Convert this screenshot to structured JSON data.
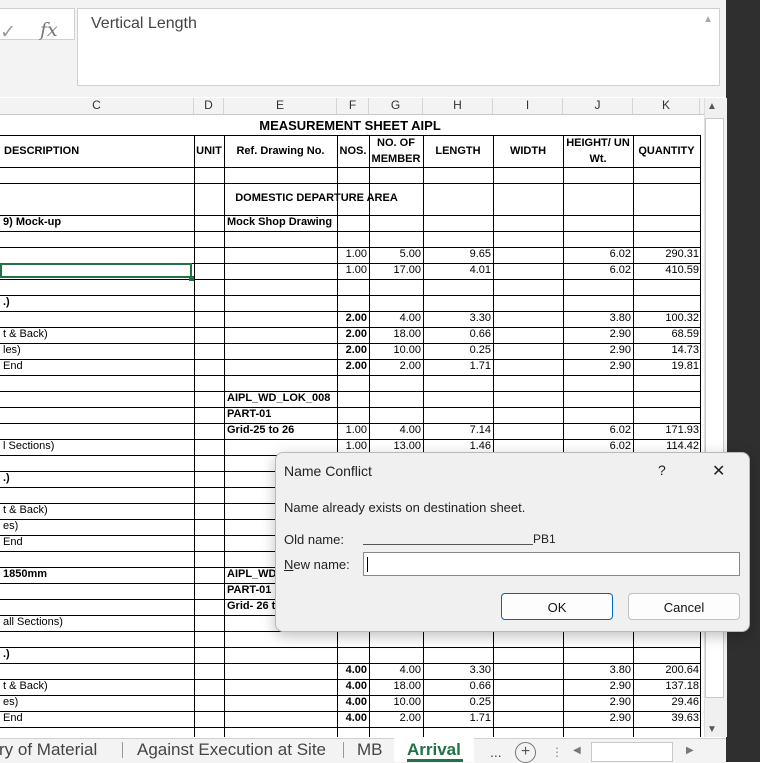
{
  "formula_bar": {
    "check_glyph": "✓",
    "fx_label": "fx",
    "value": "Vertical Length"
  },
  "columns": [
    "C",
    "D",
    "E",
    "F",
    "G",
    "H",
    "I",
    "J",
    "K"
  ],
  "sheet": {
    "title": "MEASUREMENT SHEET AIPL",
    "headers": {
      "description": "DESCRIPTION",
      "unit": "UNIT",
      "ref_drawing": "Ref. Drawing No.",
      "nos": "NOS.",
      "no_of_member_1": "NO. OF",
      "no_of_member_2": "MEMBER",
      "length": "LENGTH",
      "width": "WIDTH",
      "height_1": "HEIGHT/ UN",
      "height_2": "Wt.",
      "quantity": "QUANTITY"
    },
    "section": "DOMESTIC DEPARTURE AREA",
    "rows": [
      {
        "c": "9) Mock-up",
        "e": "Mock Shop Drawing",
        "bold_c": true,
        "bold_e": true
      },
      {},
      {
        "f": "1.00",
        "g": "5.00",
        "h": "9.65",
        "j": "6.02",
        "k": "290.31"
      },
      {
        "f": "1.00",
        "g": "17.00",
        "h": "4.01",
        "j": "6.02",
        "k": "410.59"
      },
      {},
      {
        "c": ".)",
        "bold_c": true
      },
      {
        "f": "2.00",
        "g": "4.00",
        "h": "3.30",
        "j": "3.80",
        "k": "100.32",
        "bold_f": true
      },
      {
        "c": "t & Back)",
        "f": "2.00",
        "g": "18.00",
        "h": "0.66",
        "j": "2.90",
        "k": "68.59",
        "bold_f": true
      },
      {
        "c": "les)",
        "f": "2.00",
        "g": "10.00",
        "h": "0.25",
        "j": "2.90",
        "k": "14.73",
        "bold_f": true
      },
      {
        "c": " End",
        "f": "2.00",
        "g": "2.00",
        "h": "1.71",
        "j": "2.90",
        "k": "19.81",
        "bold_f": true
      },
      {},
      {
        "e": "AIPL_WD_LOK_008",
        "bold_e": true
      },
      {
        "e": "PART-01",
        "bold_e": true
      },
      {
        "e": "Grid-25 to 26",
        "f": "1.00",
        "g": "4.00",
        "h": "7.14",
        "j": "6.02",
        "k": "171.93",
        "bold_e": true
      },
      {
        "c": "l Sections)",
        "f": "1.00",
        "g": "13.00",
        "h": "1.46",
        "j": "6.02",
        "k": "114.42"
      },
      {},
      {
        "c": ".)",
        "bold_c": true
      },
      {},
      {
        "c": "t & Back)"
      },
      {
        "c": "es)"
      },
      {
        "c": " End"
      },
      {},
      {
        "c": "1850mm",
        "e": "AIPL_WD",
        "bold_c": true,
        "bold_e": true
      },
      {
        "e": "PART-01",
        "bold_e": true
      },
      {
        "e": "Grid- 26 t",
        "bold_e": true
      },
      {
        "c": "all Sections)"
      },
      {},
      {
        "c": ".)",
        "bold_c": true
      },
      {
        "f": "4.00",
        "g": "4.00",
        "h": "3.30",
        "j": "3.80",
        "k": "200.64",
        "bold_f": true
      },
      {
        "c": "t & Back)",
        "f": "4.00",
        "g": "18.00",
        "h": "0.66",
        "j": "2.90",
        "k": "137.18",
        "bold_f": true
      },
      {
        "c": "es)",
        "f": "4.00",
        "g": "10.00",
        "h": "0.25",
        "j": "2.90",
        "k": "29.46",
        "bold_f": true
      },
      {
        "c": " End",
        "f": "4.00",
        "g": "2.00",
        "h": "1.71",
        "j": "2.90",
        "k": "39.63",
        "bold_f": true
      }
    ]
  },
  "tabs": [
    {
      "label": "ry of Material",
      "active": false
    },
    {
      "label": "Against Execution at Site",
      "active": false
    },
    {
      "label": "MB",
      "active": false
    },
    {
      "label": "Arrival",
      "active": true
    },
    {
      "label": "...",
      "active": false
    }
  ],
  "tab_controls": {
    "add": "+",
    "left": "◀",
    "right": "▶"
  },
  "dialog": {
    "title": "Name Conflict",
    "help": "?",
    "close": "✕",
    "message": "Name already exists on destination sheet.",
    "old_name_label": "Old name:",
    "old_name_value": "PB1",
    "new_name_label": "New name:",
    "new_name_value": "",
    "ok_label": "OK",
    "cancel_label": "Cancel",
    "accent": "#0067c0"
  },
  "colors": {
    "accent_green": "#217346",
    "selection": "#217346"
  }
}
